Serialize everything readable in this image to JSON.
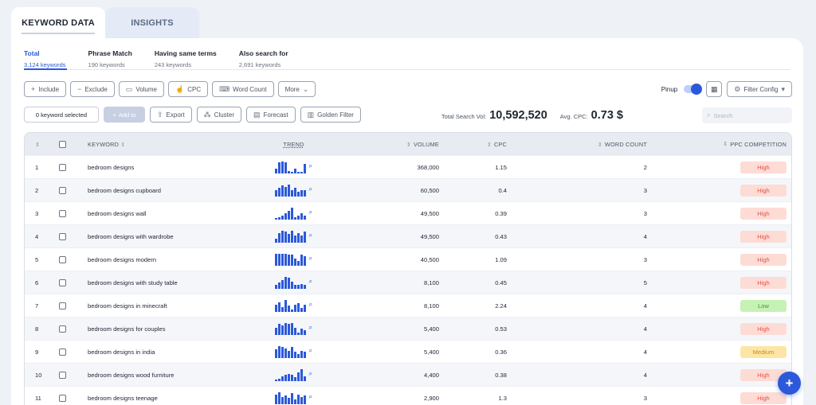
{
  "tabs": [
    {
      "label": "KEYWORD DATA"
    },
    {
      "label": "INSIGHTS"
    }
  ],
  "subtabs": [
    {
      "title": "Total",
      "count": "3,124 keywords"
    },
    {
      "title": "Phrase Match",
      "count": "190 keywords"
    },
    {
      "title": "Having same terms",
      "count": "243 keywords"
    },
    {
      "title": "Also search for",
      "count": "2,691 keywords"
    }
  ],
  "toolbar": {
    "include": "Include",
    "exclude": "Exclude",
    "volume": "Volume",
    "cpc": "CPC",
    "word_count": "Word Count",
    "more": "More",
    "pinup": "Pinup",
    "filter_config": "Filter Config"
  },
  "actions": {
    "selected": "0 keyword selected",
    "add_to": "Add to",
    "export": "Export",
    "cluster": "Cluster",
    "forecast": "Forecast",
    "golden_filter": "Golden Filter"
  },
  "stats": {
    "total_label": "Total Search Vol:",
    "total_value": "10,592,520",
    "cpc_label": "Avg. CPC:",
    "cpc_value": "0.73 $"
  },
  "search": {
    "placeholder": "Search"
  },
  "columns": {
    "keyword": "KEYWORD",
    "trend": "TREND",
    "volume": "VOLUME",
    "cpc": "CPC",
    "word_count": "WORD COUNT",
    "ppc": "PPC COMPETITION"
  },
  "rows": [
    {
      "n": "1",
      "kw": "bedroom designs",
      "vol": "368,000",
      "cpc": "1.15",
      "wc": "2",
      "ppc": "High",
      "level": "high",
      "trend": [
        0.4,
        0.9,
        1,
        0.9,
        0.2,
        0.1,
        0.4,
        0.1,
        0.1,
        0.8
      ]
    },
    {
      "n": "2",
      "kw": "bedroom designs cupboard",
      "vol": "60,500",
      "cpc": "0.4",
      "wc": "3",
      "ppc": "High",
      "level": "high",
      "trend": [
        0.5,
        0.7,
        0.9,
        0.8,
        1,
        0.5,
        0.7,
        0.4,
        0.5,
        0.5
      ]
    },
    {
      "n": "3",
      "kw": "bedroom designs wall",
      "vol": "49,500",
      "cpc": "0.39",
      "wc": "3",
      "ppc": "High",
      "level": "high",
      "trend": [
        0.1,
        0.2,
        0.3,
        0.5,
        0.7,
        1,
        0.2,
        0.3,
        0.5,
        0.3
      ]
    },
    {
      "n": "4",
      "kw": "bedroom designs with wardrobe",
      "vol": "49,500",
      "cpc": "0.43",
      "wc": "4",
      "ppc": "High",
      "level": "high",
      "trend": [
        0.3,
        0.8,
        1,
        0.9,
        0.7,
        1,
        0.6,
        0.8,
        0.6,
        0.9
      ]
    },
    {
      "n": "5",
      "kw": "bedroom designs modern",
      "vol": "40,500",
      "cpc": "1.09",
      "wc": "3",
      "ppc": "High",
      "level": "high",
      "trend": [
        1,
        1,
        1,
        1,
        0.9,
        0.9,
        0.6,
        0.4,
        0.9,
        0.8
      ]
    },
    {
      "n": "6",
      "kw": "bedroom designs with study table",
      "vol": "8,100",
      "cpc": "0.45",
      "wc": "5",
      "ppc": "High",
      "level": "high",
      "trend": [
        0.3,
        0.5,
        0.7,
        1,
        0.9,
        0.6,
        0.3,
        0.3,
        0.4,
        0.3
      ]
    },
    {
      "n": "7",
      "kw": "bedroom designs in minecraft",
      "vol": "8,100",
      "cpc": "2.24",
      "wc": "4",
      "ppc": "Low",
      "level": "low",
      "trend": [
        0.6,
        0.8,
        0.4,
        1,
        0.5,
        0.2,
        0.6,
        0.7,
        0.3,
        0.6
      ]
    },
    {
      "n": "8",
      "kw": "bedroom designs for couples",
      "vol": "5,400",
      "cpc": "0.53",
      "wc": "4",
      "ppc": "High",
      "level": "high",
      "trend": [
        0.6,
        0.9,
        0.8,
        1,
        0.9,
        1,
        0.6,
        0.2,
        0.5,
        0.4
      ]
    },
    {
      "n": "9",
      "kw": "bedroom designs in india",
      "vol": "5,400",
      "cpc": "0.36",
      "wc": "4",
      "ppc": "Medium",
      "level": "medium",
      "trend": [
        0.7,
        1,
        0.9,
        0.8,
        0.6,
        0.9,
        0.5,
        0.3,
        0.6,
        0.5
      ]
    },
    {
      "n": "10",
      "kw": "bedroom designs wood furniture",
      "vol": "4,400",
      "cpc": "0.38",
      "wc": "4",
      "ppc": "High",
      "level": "high",
      "trend": [
        0.1,
        0.2,
        0.4,
        0.5,
        0.6,
        0.5,
        0.3,
        0.7,
        1,
        0.4
      ]
    },
    {
      "n": "11",
      "kw": "bedroom designs teenage",
      "vol": "2,900",
      "cpc": "1.3",
      "wc": "3",
      "ppc": "High",
      "level": "high",
      "trend": [
        0.8,
        1,
        0.6,
        0.7,
        0.5,
        0.9,
        0.4,
        0.8,
        0.6,
        0.7
      ]
    }
  ],
  "colors": {
    "accent": "#2b59d9",
    "high_bg": "#fddcd5",
    "low_bg": "#c6f2b5",
    "medium_bg": "#fde6a5"
  }
}
